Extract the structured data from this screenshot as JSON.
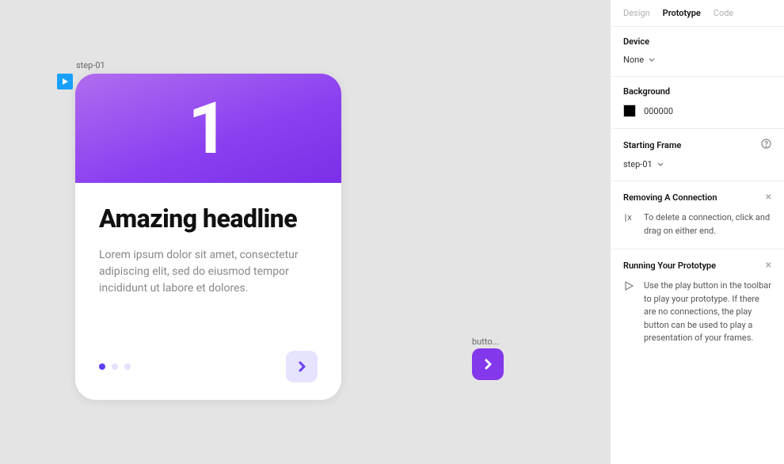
{
  "canvas": {
    "frame_label": "step-01",
    "card": {
      "hero_number": "1",
      "headline": "Amazing headline",
      "body_text": "Lorem ipsum dolor sit amet, consectetur adipiscing elit, sed do eiusmod tempor incididunt ut labore et dolores."
    },
    "button_frame_label": "butto..."
  },
  "panel": {
    "tabs": {
      "design": "Design",
      "prototype": "Prototype",
      "code": "Code"
    },
    "device": {
      "title": "Device",
      "value": "None"
    },
    "background": {
      "title": "Background",
      "value": "000000",
      "color": "#000000"
    },
    "starting_frame": {
      "title": "Starting Frame",
      "value": "step-01"
    },
    "help1": {
      "title": "Removing A Connection",
      "text": "To delete a connection, click and drag on either end."
    },
    "help2": {
      "title": "Running Your Prototype",
      "text": "Use the play button in the toolbar to play your prototype. If there are no connections, the play button can be used to play a presentation of your frames."
    }
  }
}
